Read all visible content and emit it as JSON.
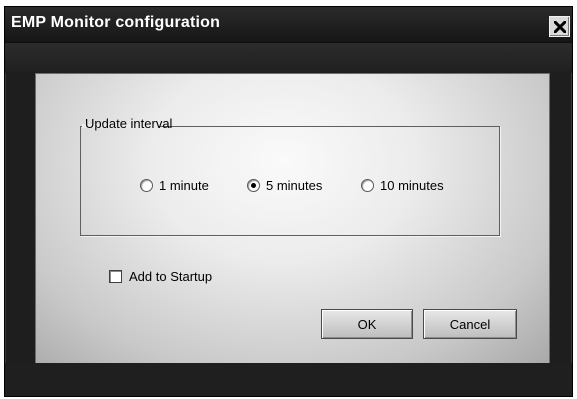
{
  "window": {
    "title": "EMP Monitor configuration",
    "close_icon": "close-icon"
  },
  "update_interval": {
    "legend": "Update interval",
    "options": [
      {
        "label": "1 minute",
        "selected": false
      },
      {
        "label": "5 minutes",
        "selected": true
      },
      {
        "label": "10 minutes",
        "selected": false
      }
    ]
  },
  "startup": {
    "label": "Add to Startup",
    "checked": false
  },
  "buttons": {
    "ok_label": "OK",
    "cancel_label": "Cancel"
  },
  "colors": {
    "titlebar": "#1e1e1e",
    "panel": "#e6e6e6",
    "title_text": "#ffffff"
  }
}
